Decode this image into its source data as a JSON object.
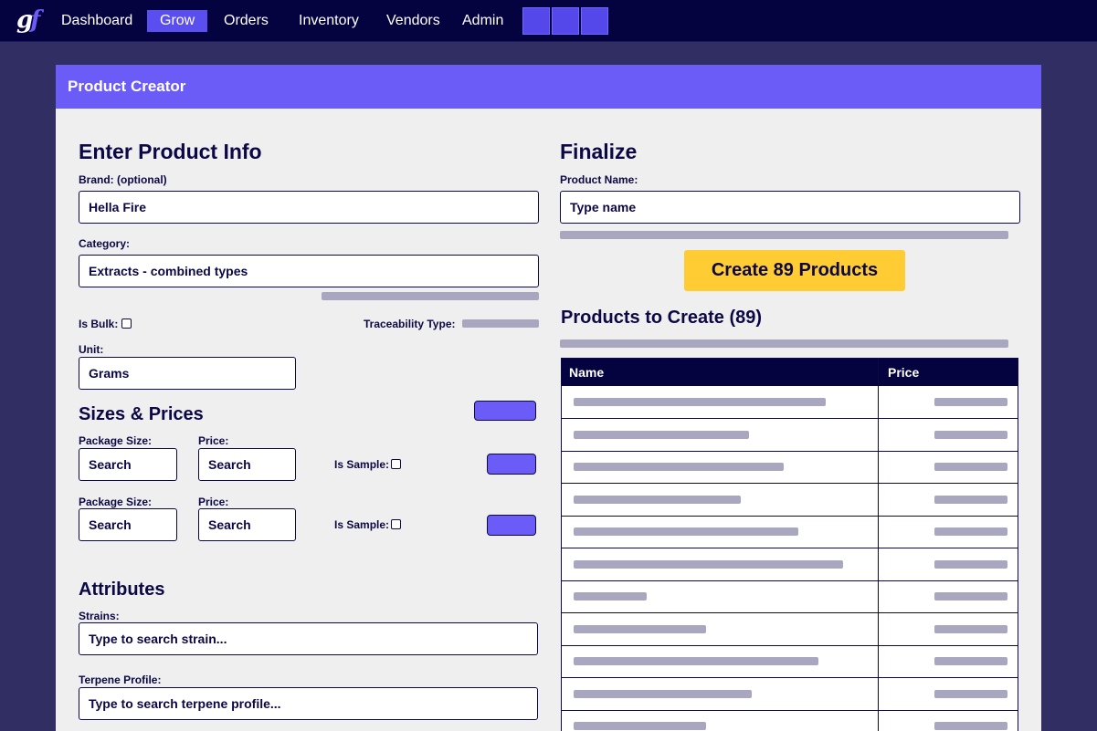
{
  "nav": {
    "logo": "gf",
    "items": [
      "Dashboard",
      "Grow",
      "Orders",
      "Inventory",
      "Vendors",
      "Admin"
    ],
    "active": "Grow"
  },
  "panel": {
    "title": "Product Creator"
  },
  "product_info": {
    "heading": "Enter Product Info",
    "brand_label": "Brand: (optional)",
    "brand_value": "Hella Fire",
    "category_label": "Category:",
    "category_value": "Extracts - combined types",
    "is_bulk_label": "Is Bulk:",
    "traceability_label": "Traceability Type:",
    "unit_label": "Unit:",
    "unit_value": "Grams"
  },
  "sizes": {
    "heading": "Sizes & Prices",
    "rows": [
      {
        "package_label": "Package Size:",
        "package_value": "Search",
        "price_label": "Price:",
        "price_value": "Search",
        "sample_label": "Is Sample:"
      },
      {
        "package_label": "Package Size:",
        "package_value": "Search",
        "price_label": "Price:",
        "price_value": "Search",
        "sample_label": "Is Sample:"
      }
    ]
  },
  "attributes": {
    "heading": "Attributes",
    "strains_label": "Strains:",
    "strains_placeholder": "Type to search strain...",
    "terpene_label": "Terpene Profile:",
    "terpene_placeholder": "Type to search terpene profile..."
  },
  "finalize": {
    "heading": "Finalize",
    "name_label": "Product Name:",
    "name_placeholder": "Type name",
    "create_button": "Create 89 Products"
  },
  "products_table": {
    "heading": "Products to Create (89)",
    "columns": [
      "Name",
      "Price"
    ],
    "row_count": 11
  },
  "colors": {
    "nav_bg": "#04023f",
    "accent": "#6b5cf7",
    "cta": "#ffcc33",
    "page_bg": "#312e63",
    "panel_bg": "#efefef",
    "placeholder_bar": "#a9a7bf"
  }
}
